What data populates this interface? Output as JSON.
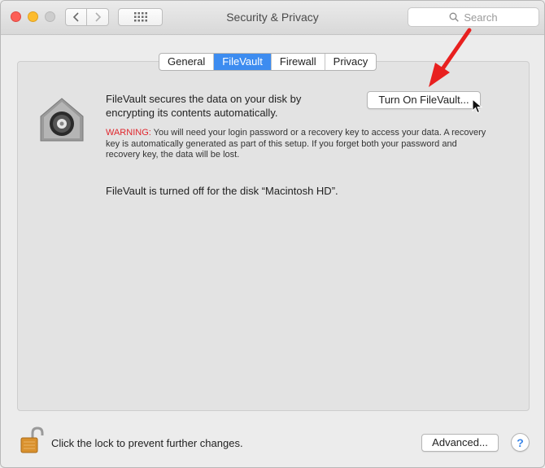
{
  "window": {
    "title": "Security & Privacy",
    "search_placeholder": "Search"
  },
  "tabs": [
    {
      "label": "General",
      "active": false
    },
    {
      "label": "FileVault",
      "active": true
    },
    {
      "label": "Firewall",
      "active": false
    },
    {
      "label": "Privacy",
      "active": false
    }
  ],
  "filevault": {
    "description": "FileVault secures the data on your disk by encrypting its contents automatically.",
    "warning_label": "WARNING:",
    "warning_text": " You will need your login password or a recovery key to access your data. A recovery key is automatically generated as part of this setup. If you forget both your password and recovery key, the data will be lost.",
    "status": "FileVault is turned off for the disk “Macintosh HD”.",
    "turn_on_button": "Turn On FileVault..."
  },
  "footer": {
    "lock_text": "Click the lock to prevent further changes.",
    "advanced_button": "Advanced...",
    "help_button": "?"
  },
  "colors": {
    "accent": "#3d8cf0",
    "warning": "#e0262d",
    "annotation_arrow": "#e8201f"
  },
  "icons": {
    "vault": "filevault-safe-icon",
    "lock": "unlocked-padlock-icon",
    "search": "search-icon"
  }
}
